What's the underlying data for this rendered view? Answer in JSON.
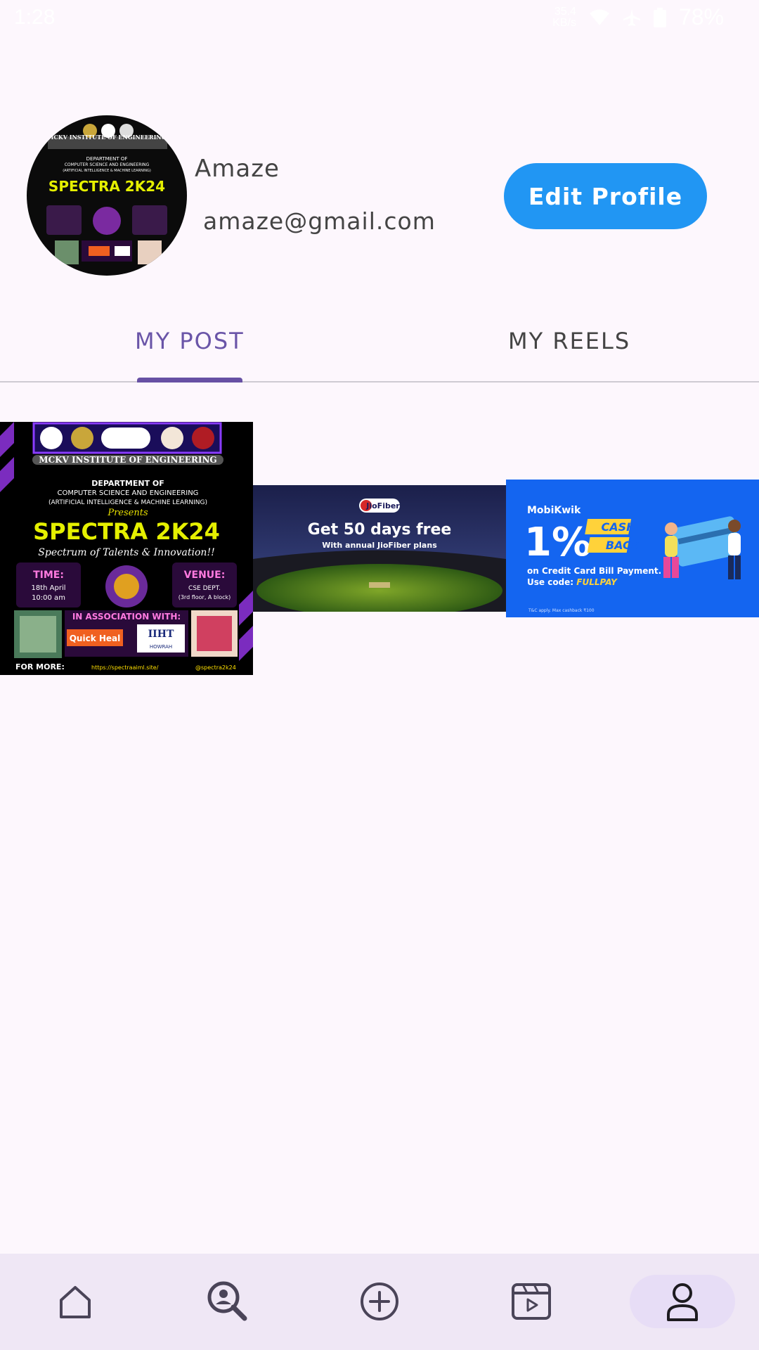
{
  "status_bar": {
    "time": "1:28",
    "network_top": "35.4",
    "network_bottom": "KB/s",
    "battery": "78%"
  },
  "profile": {
    "name": "Amaze",
    "email": "amaze@gmail.com",
    "edit_label": "Edit Profile"
  },
  "tabs": [
    {
      "label": "MY POST",
      "selected": true
    },
    {
      "label": "MY REELS",
      "selected": false
    }
  ],
  "poster": {
    "college": "MCKV INSTITUTE OF ENGINEERING",
    "dept1": "DEPARTMENT OF",
    "dept2": "COMPUTER SCIENCE AND ENGINEERING",
    "dept3": "(ARTIFICIAL INTELLIGENCE & MACHINE LEARNING)",
    "presents": "Presents",
    "title": "SPECTRA 2K24",
    "tagline": "Spectrum of Talents & Innovation!!",
    "time_label": "TIME:",
    "time_value1": "18th April",
    "time_value2": "10:00 am",
    "venue_label": "VENUE:",
    "venue_value1": "CSE DEPT.",
    "venue_value2": "(3rd floor, A block)",
    "assoc": "IN ASSOCIATION WITH:",
    "sponsor1": "Quick Heal",
    "sponsor2": "IIHT",
    "sponsor2_sub": "HOWRAH",
    "footer_left": "FOR MORE:",
    "footer_link": "https://spectraaiml.site/",
    "footer_insta": "@spectra2k24"
  },
  "ad_jio": {
    "brand": "JioFiber",
    "headline": "Get 50 days free",
    "subline": "With annual JioFiber plans"
  },
  "ad_mobikwik": {
    "brand": "MobiKwik",
    "percent": "1%",
    "cash": "CASH",
    "back": "BACK",
    "line1": "on Credit Card Bill Payment.",
    "line2_prefix": "Use code: ",
    "code": "FULLPAY",
    "fine": "T&C apply. Max cashback ₹100"
  },
  "bottom_nav": [
    {
      "icon": "home-icon",
      "label": "Home",
      "active": false
    },
    {
      "icon": "search-icon",
      "label": "Search",
      "active": false
    },
    {
      "icon": "add-icon",
      "label": "Add",
      "active": false
    },
    {
      "icon": "reels-icon",
      "label": "Reels",
      "active": false
    },
    {
      "icon": "profile-icon",
      "label": "Profile",
      "active": true
    }
  ],
  "colors": {
    "accent": "#6750a4",
    "button": "#2196f3",
    "background": "#fdf7fd"
  }
}
